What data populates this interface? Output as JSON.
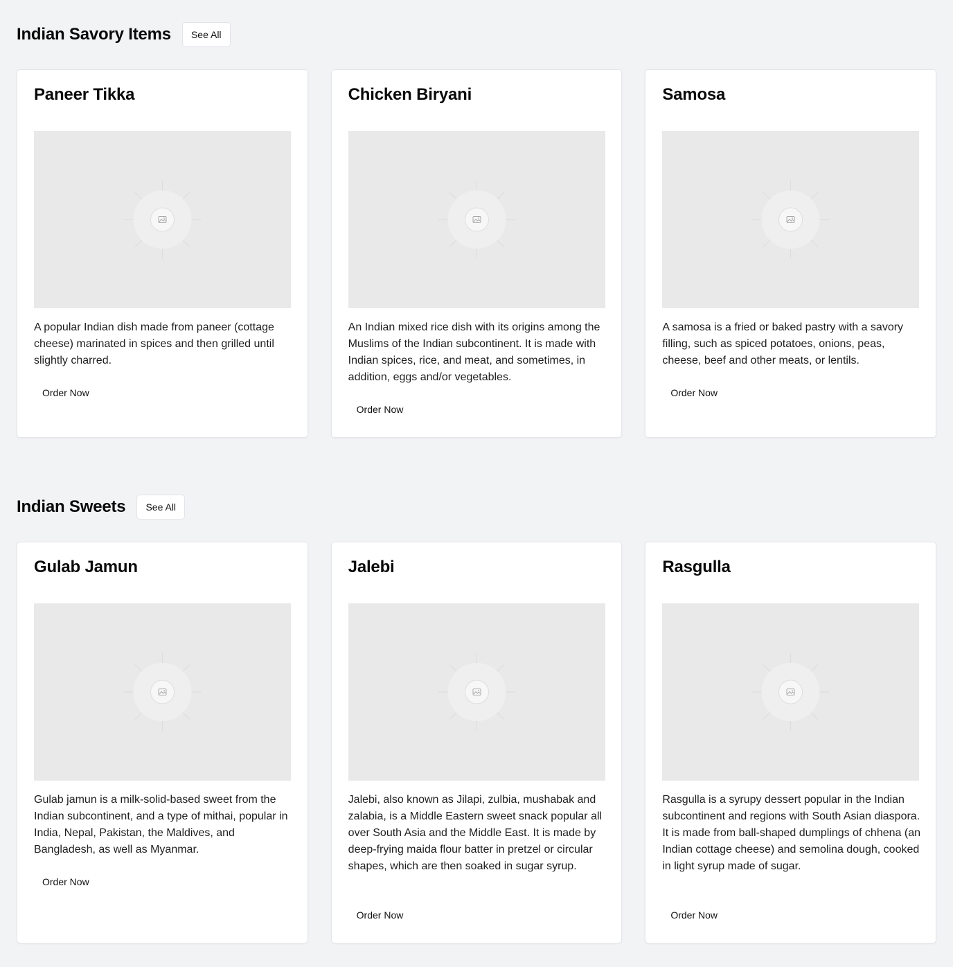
{
  "sections": [
    {
      "title": "Indian Savory Items",
      "see_all_label": "See All",
      "cards": [
        {
          "title": "Paneer Tikka",
          "description": "A popular Indian dish made from paneer (cottage cheese) marinated in spices and then grilled until slightly charred.",
          "button_label": "Order Now"
        },
        {
          "title": "Chicken Biryani",
          "description": "An Indian mixed rice dish with its origins among the Muslims of the Indian subcontinent. It is made with Indian spices, rice, and meat, and sometimes, in addition, eggs and/or vegetables.",
          "button_label": "Order Now"
        },
        {
          "title": "Samosa",
          "description": "A samosa is a fried or baked pastry with a savory filling, such as spiced potatoes, onions, peas, cheese, beef and other meats, or lentils.",
          "button_label": "Order Now"
        }
      ]
    },
    {
      "title": "Indian Sweets",
      "see_all_label": "See All",
      "cards": [
        {
          "title": "Gulab Jamun",
          "description": "Gulab jamun is a milk-solid-based sweet from the Indian subcontinent, and a type of mithai, popular in India, Nepal, Pakistan, the Maldives, and Bangladesh, as well as Myanmar.",
          "button_label": "Order Now"
        },
        {
          "title": "Jalebi",
          "description": "Jalebi, also known as Jilapi, zulbia, mushabak and zalabia, is a Middle Eastern sweet snack popular all over South Asia and the Middle East. It is made by deep-frying maida flour batter in pretzel or circular shapes, which are then soaked in sugar syrup.",
          "button_label": "Order Now"
        },
        {
          "title": "Rasgulla",
          "description": "Rasgulla is a syrupy dessert popular in the Indian subcontinent and regions with South Asian diaspora. It is made from ball-shaped dumplings of chhena (an Indian cottage cheese) and semolina dough, cooked in light syrup made of sugar.",
          "button_label": "Order Now"
        }
      ]
    }
  ],
  "placeholder_icon": "image-placeholder-icon",
  "colors": {
    "page_background": "#f2f3f5",
    "card_background": "#ffffff",
    "image_placeholder": "#e9e9e9"
  }
}
